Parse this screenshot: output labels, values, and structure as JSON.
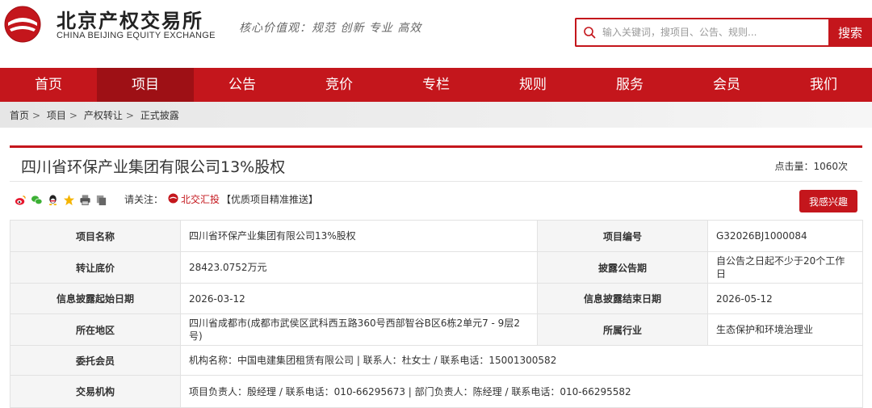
{
  "header": {
    "brand_cn": "北京产权交易所",
    "brand_en": "CHINA BEIJING EQUITY EXCHANGE",
    "slogan": "核心价值观：规范 创新 专业 高效",
    "search_placeholder": "输入关键词，搜项目、公告、规则...",
    "search_button": "搜索",
    "brand_color": "#c4161c"
  },
  "nav": {
    "items": [
      "首页",
      "项目",
      "公告",
      "竞价",
      "专栏",
      "规则",
      "服务",
      "会员",
      "我们"
    ],
    "active": "项目"
  },
  "breadcrumb": [
    "首页",
    "项目",
    "产权转让",
    "正式披露"
  ],
  "project": {
    "title": "四川省环保产业集团有限公司13%股权",
    "clicks": "点击量：1060次"
  },
  "share": {
    "icons": [
      "weibo-icon",
      "wechat-icon",
      "qq-icon",
      "favorite-star-icon",
      "print-icon",
      "copy-icon"
    ],
    "follow_label": "请关注：",
    "follow_link": "北交汇投",
    "follow_tail": "【优质项目精准推送】",
    "interest_button": "我感兴趣"
  },
  "info": {
    "project_name_label": "项目名称",
    "project_name": "四川省环保产业集团有限公司13%股权",
    "project_code_label": "项目编号",
    "project_code": "G32026BJ1000084",
    "reserve_price_label": "转让底价",
    "reserve_price": "28423.0752万元",
    "disclosure_period_label": "披露公告期",
    "disclosure_period": "自公告之日起不少于20个工作日",
    "start_date_label": "信息披露起始日期",
    "start_date": "2026-03-12",
    "end_date_label": "信息披露结束日期",
    "end_date": "2026-05-12",
    "location_label": "所在地区",
    "location": "四川省成都市(成都市武侯区武科西五路360号西部智谷B区6栋2单元7 - 9层2号)",
    "industry_label": "所属行业",
    "industry": "生态保护和环境治理业",
    "member_label": "委托会员",
    "member": "机构名称：中国电建集团租赁有限公司 | 联系人：杜女士 / 联系电话：15001300582",
    "exchange_label": "交易机构",
    "exchange": "项目负责人：殷经理 / 联系电话：010-66295673 | 部门负责人：陈经理 / 联系电话：010-66295582"
  }
}
